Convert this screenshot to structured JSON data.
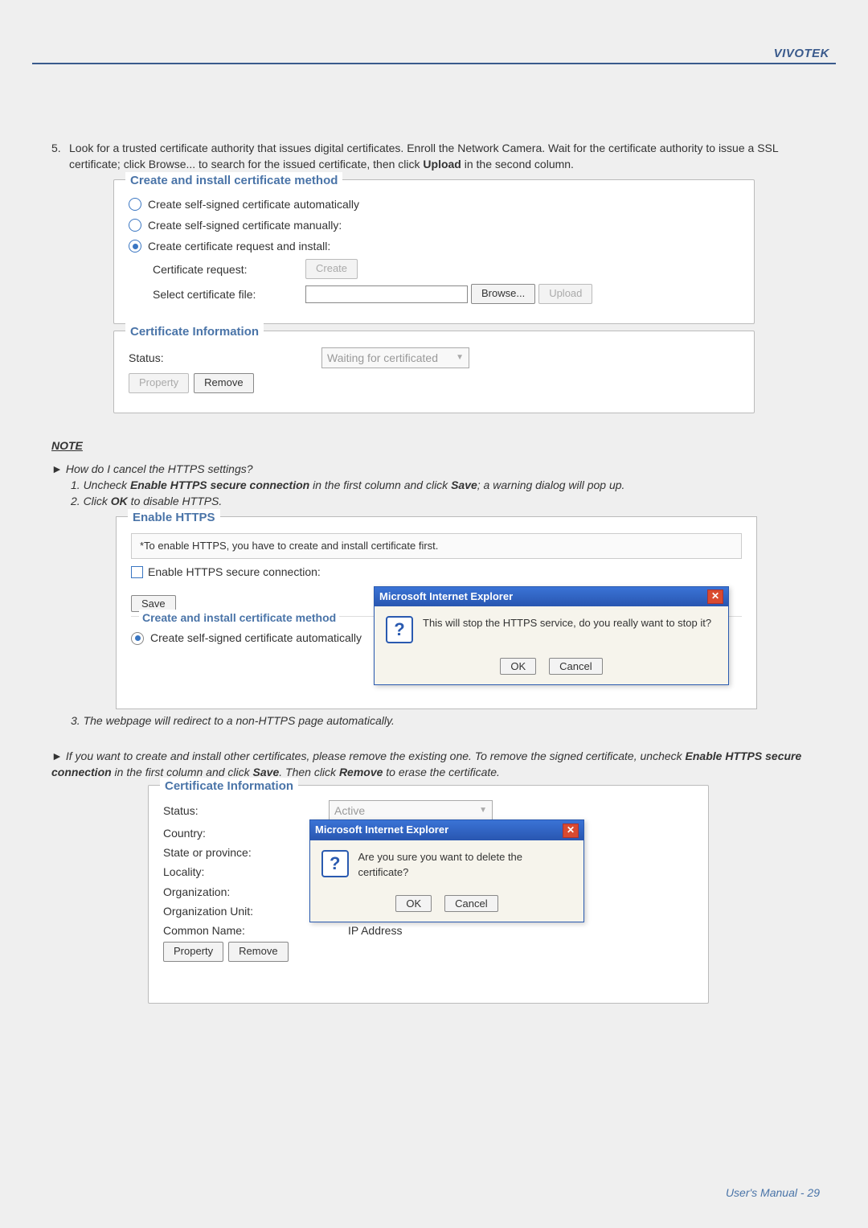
{
  "brand": "VIVOTEK",
  "intro": {
    "num": "5.",
    "text_a": "Look for a trusted certificate authority that issues digital certificates. Enroll the Network Camera. Wait for the certificate authority to issue a SSL certificate; click Browse... to search for the issued certificate, then click ",
    "text_b": "Upload",
    "text_c": " in the second column."
  },
  "fs1": {
    "legend": "Create and install certificate method",
    "opt1": "Create self-signed certificate automatically",
    "opt2": "Create self-signed certificate manually:",
    "opt3": "Create certificate request and install:",
    "cr_lbl": "Certificate request:",
    "cr_btn": "Create",
    "sf_lbl": "Select certificate file:",
    "browse": "Browse...",
    "upload": "Upload"
  },
  "fs2": {
    "legend": "Certificate Information",
    "status_lbl": "Status:",
    "status_val": "Waiting for certificated",
    "prop": "Property",
    "remove": "Remove"
  },
  "note": "NOTE",
  "q1": {
    "head": "How do I cancel the HTTPS settings?",
    "l1a": "1. Uncheck ",
    "l1b": "Enable HTTPS secure connection",
    "l1c": " in the first column and click ",
    "l1d": "Save",
    "l1e": "; a warning dialog will pop up.",
    "l2a": "2. Click ",
    "l2b": "OK",
    "l2c": " to disable HTTPS."
  },
  "sb1": {
    "legend": "Enable HTTPS",
    "note": "*To enable HTTPS, you have to create and install certificate first.",
    "chk": "Enable HTTPS secure connection:",
    "save": "Save",
    "method": "Create and install certificate method",
    "auto": "Create self-signed certificate automatically",
    "dlgtitle": "Microsoft Internet Explorer",
    "dlgmsg": "This will stop the HTTPS service, do you really want to stop it?",
    "ok": "OK",
    "cancel": "Cancel"
  },
  "l3": "3. The webpage will redirect to a non-HTTPS page automatically.",
  "q2": {
    "a": "If you want to create and install other certificates, please remove the existing one. To remove the signed certificate, uncheck ",
    "b": "Enable HTTPS secure connection",
    "c": " in the first column and click ",
    "d": "Save",
    "e": ". Then click ",
    "f": "Remove",
    "g": " to erase the certificate."
  },
  "sb2": {
    "legend": "Certificate Information",
    "status": "Status:",
    "status_v": "Active",
    "country": "Country:",
    "state": "State or province:",
    "loc": "Locality:",
    "org": "Organization:",
    "ou": "Organization Unit:",
    "cn": "Common Name:",
    "cn_v": "IP Address",
    "prop": "Property",
    "remove": "Remove",
    "dlgtitle": "Microsoft Internet Explorer",
    "dlgmsg": "Are you sure you want to delete the certificate?",
    "ok": "OK",
    "cancel": "Cancel"
  },
  "footer": "User's Manual - 29"
}
